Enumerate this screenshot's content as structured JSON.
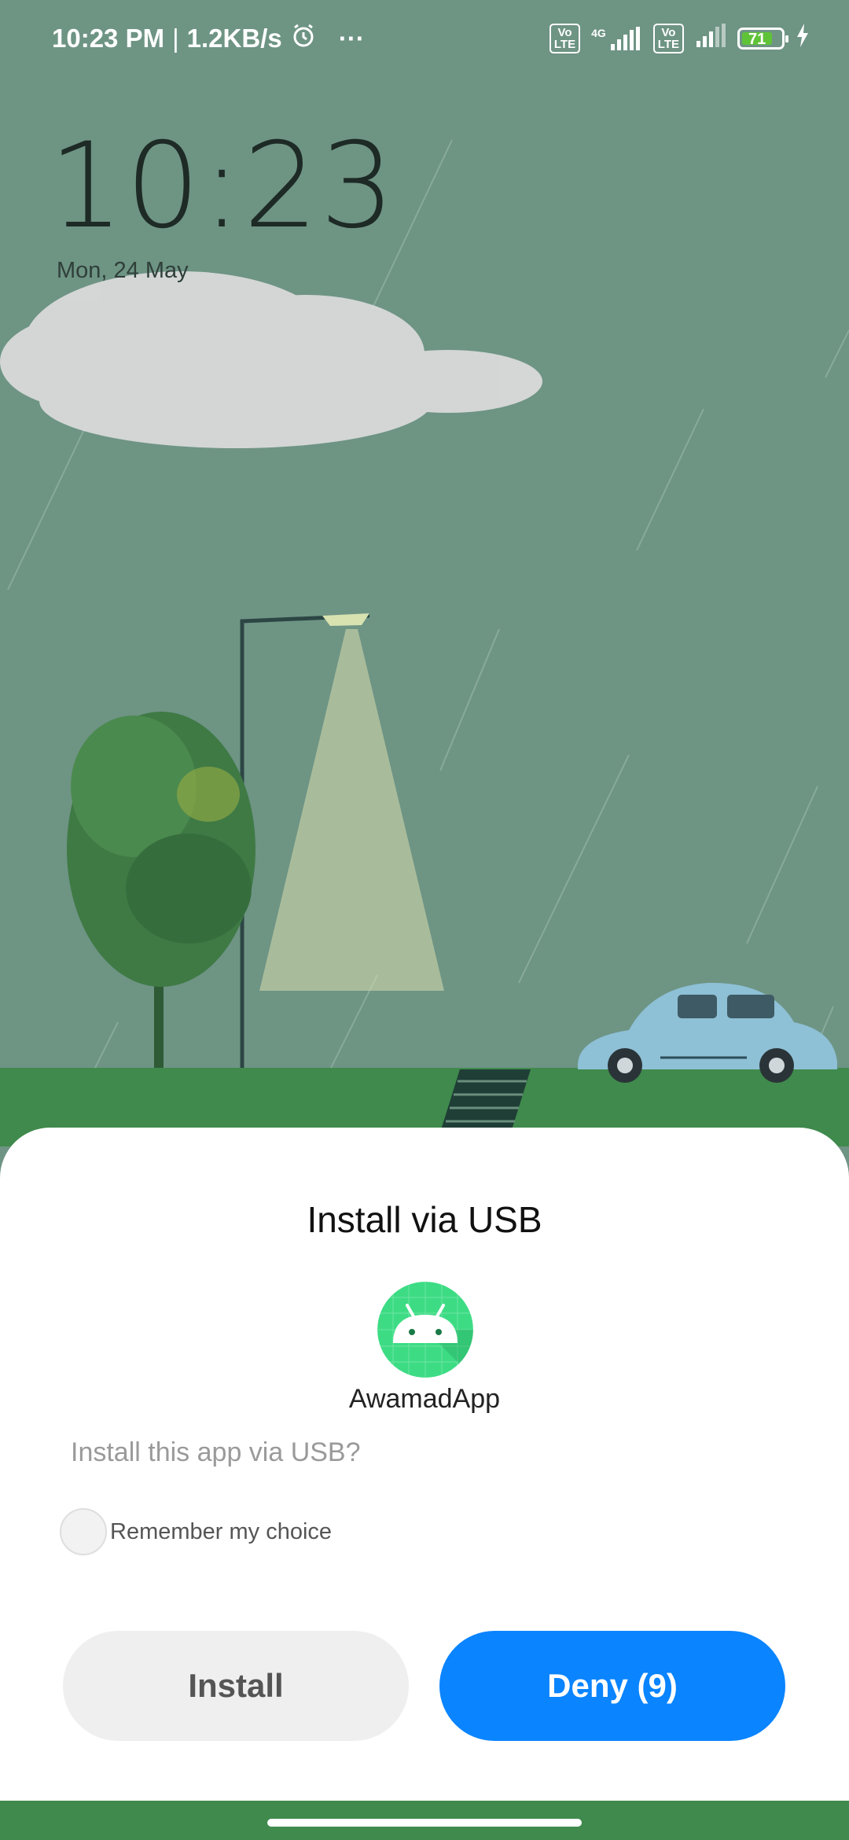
{
  "status_bar": {
    "time": "10:23 PM",
    "separator": "|",
    "network_speed": "1.2KB/s",
    "alarm_icon": "alarm-icon",
    "more_indicator": "···",
    "volte1": "Vo\nLTE",
    "network_type": "4G",
    "volte2": "Vo\nLTE",
    "battery_level": "71",
    "charging_icon": "bolt-icon"
  },
  "lockscreen": {
    "clock": "10:23",
    "date": "Mon, 24 May"
  },
  "dialog": {
    "title": "Install via USB",
    "app_icon": "android-icon",
    "app_name": "AwamadApp",
    "question": "Install this app via USB?",
    "remember_label": "Remember my choice",
    "remember_checked": false,
    "install_label": "Install",
    "deny_label": "Deny (9)"
  },
  "colors": {
    "accent": "#0a84ff",
    "wallpaper": "#6e9484",
    "grass": "#3f8a4c",
    "battery": "#5fc338",
    "app_icon_bg": "#3ddc84"
  }
}
